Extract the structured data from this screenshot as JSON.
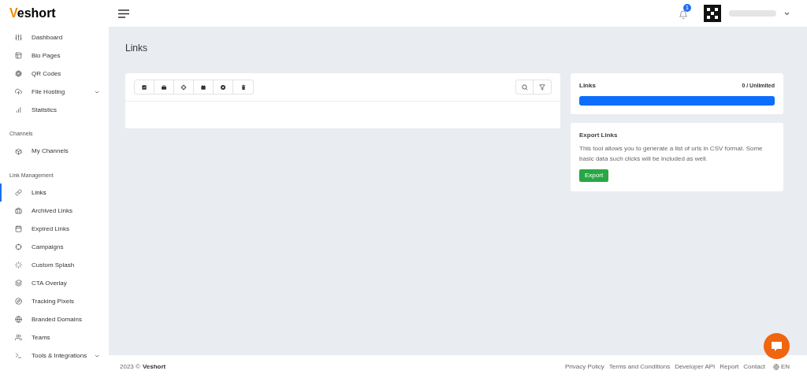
{
  "brand": {
    "initial": "V",
    "rest": "eshort"
  },
  "notifications": {
    "count": "1"
  },
  "sidebar": {
    "sections": [
      {
        "items": [
          {
            "label": "Dashboard",
            "selected": false,
            "submenu": false
          },
          {
            "label": "Bio Pages",
            "selected": false,
            "submenu": false
          },
          {
            "label": "QR Codes",
            "selected": false,
            "submenu": false
          },
          {
            "label": "File Hosting",
            "selected": false,
            "submenu": true
          },
          {
            "label": "Statistics",
            "selected": false,
            "submenu": false
          }
        ]
      },
      {
        "heading": "Channels",
        "items": [
          {
            "label": "My Channels",
            "selected": false,
            "submenu": false
          }
        ]
      },
      {
        "heading": "Link Management",
        "items": [
          {
            "label": "Links",
            "selected": true,
            "submenu": false
          },
          {
            "label": "Archived Links",
            "selected": false,
            "submenu": false
          },
          {
            "label": "Expired Links",
            "selected": false,
            "submenu": false
          },
          {
            "label": "Campaigns",
            "selected": false,
            "submenu": false
          },
          {
            "label": "Custom Splash",
            "selected": false,
            "submenu": false
          },
          {
            "label": "CTA Overlay",
            "selected": false,
            "submenu": false
          },
          {
            "label": "Tracking Pixels",
            "selected": false,
            "submenu": false
          },
          {
            "label": "Branded Domains",
            "selected": false,
            "submenu": false
          },
          {
            "label": "Teams",
            "selected": false,
            "submenu": false
          },
          {
            "label": "Tools & Integrations",
            "selected": false,
            "submenu": true
          }
        ]
      }
    ]
  },
  "page_title": "Links",
  "usage": {
    "title": "Links",
    "count": "0 / Unlimited",
    "level": 1
  },
  "export": {
    "title": "Export Links",
    "text": "This tool allows you to generate a list of urls in CSV format. Some basic data such clicks will be included as well.",
    "button": "Export"
  },
  "footer": {
    "copyright": "2023 ©",
    "brand": "Veshort",
    "links": [
      "Privacy Policy",
      "Terms and Conditions",
      "Developer API",
      "Report",
      "Contact"
    ],
    "language": "EN"
  }
}
